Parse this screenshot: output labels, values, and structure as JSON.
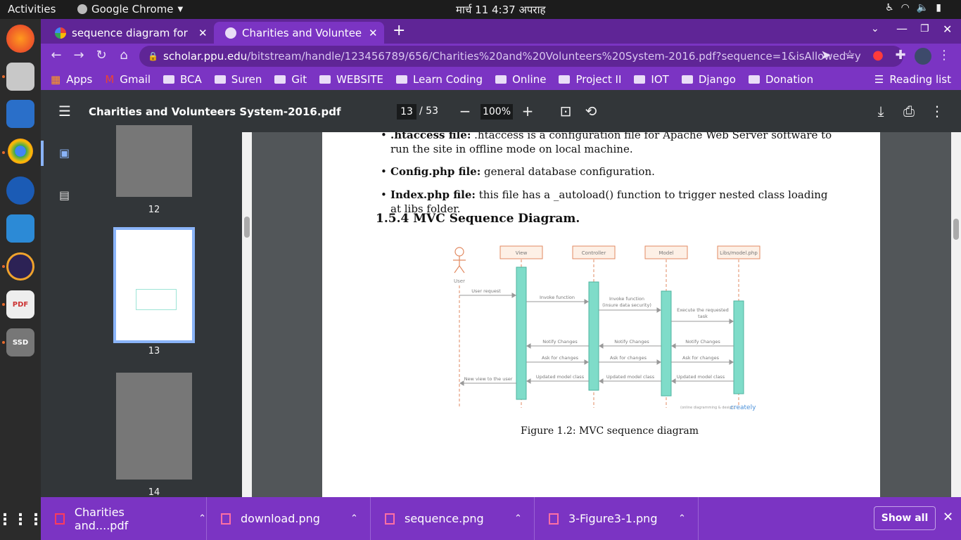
{
  "system": {
    "activities": "Activities",
    "app_name": "Google Chrome",
    "clock": "मार्च 11  4:37 अपराह"
  },
  "dock": {
    "items": [
      "firefox-icon",
      "files-icon",
      "writer-icon",
      "chrome-icon",
      "app-icon",
      "vscode-icon",
      "eclipse-icon",
      "viewer-icon",
      "ssd-icon"
    ],
    "ssd_label": "SSD"
  },
  "tabs": [
    {
      "title": "sequence diagram for cha",
      "active": false
    },
    {
      "title": "Charities and Volunteers ",
      "active": true
    }
  ],
  "omnibox": {
    "host": "scholar.ppu.edu",
    "path": "/bitstream/handle/123456789/656/Charities%20and%20Volunteers%20System-2016.pdf?sequence=1&isAllowed=y"
  },
  "bookmarks": [
    "Apps",
    "Gmail",
    "BCA",
    "Suren",
    "Git",
    "WEBSITE",
    "Learn Coding",
    "Online",
    "Project II",
    "IOT",
    "Django",
    "Donation"
  ],
  "reading_list": "Reading list",
  "pdf": {
    "filename": "Charities and Volunteers System-2016.pdf",
    "page": "13",
    "page_total": "/ 53",
    "zoom": "100%",
    "thumbs": [
      "12",
      "13",
      "14"
    ],
    "bullets": [
      {
        "bold": ".htaccess file:",
        "text": " .htaccess is a configuration file for Apache Web Server software to run the site in offline mode on local machine."
      },
      {
        "bold": "Config.php file:",
        "text": " general database configuration."
      },
      {
        "bold": "Index.php file:",
        "text": " this file has a _autoload() function to trigger nested class loading at libs folder."
      }
    ],
    "section": "1.5.4    MVC Sequence Diagram.",
    "caption": "Figure 1.2: MVC sequence diagram",
    "diagram": {
      "actor": "User",
      "lifelines": [
        "View",
        "Controller",
        "Model",
        "Libs/model.php"
      ],
      "messages": [
        "User request",
        "Invoke function",
        "Invoke function",
        "(insure data security)",
        "Execute the requested",
        "task",
        "Notify Changes",
        "Notify Changes",
        "Notify Changes",
        "Ask for changes",
        "Ask for changes",
        "Ask for changes",
        "New view to the user",
        "Updated model class",
        "Updated model class",
        "Updated model class"
      ],
      "watermark": "(online diagramming & design)",
      "logo": "creately"
    }
  },
  "downloads": {
    "items": [
      "Charities and....pdf",
      "download.png",
      "sequence.png",
      "3-Figure3-1.png"
    ],
    "show_all": "Show all"
  },
  "colors": {
    "chrome_purple": "#7b34c3",
    "tab_strip": "#5f2596",
    "lifeline": "#7fdcc9"
  }
}
